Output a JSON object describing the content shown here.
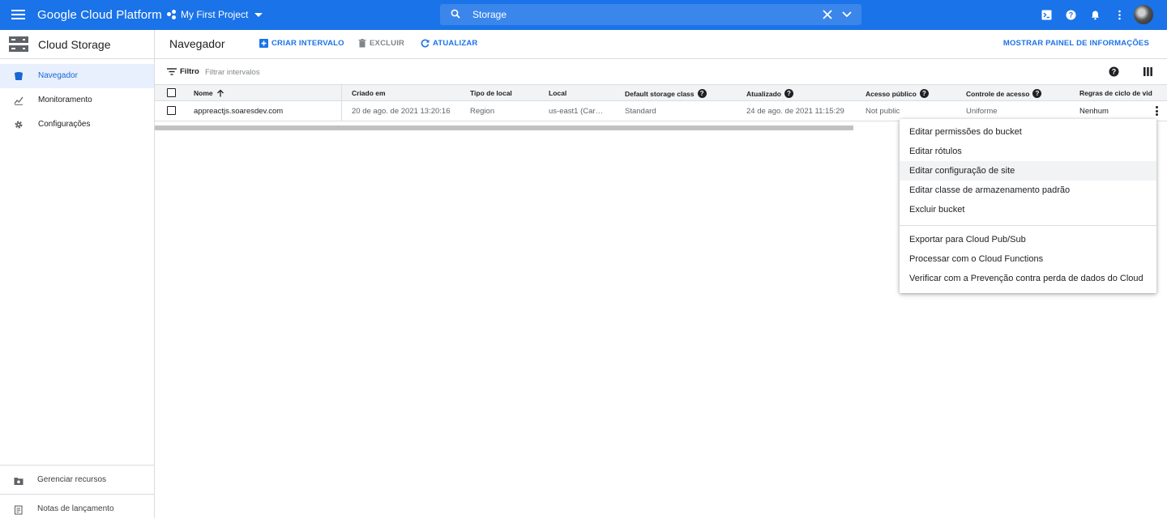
{
  "topbar": {
    "brand": "Google Cloud Platform",
    "project": "My First Project",
    "search_value": "Storage"
  },
  "sidebar": {
    "title": "Cloud Storage",
    "items": [
      {
        "label": "Navegador",
        "icon": "bucket-icon",
        "active": true
      },
      {
        "label": "Monitoramento",
        "icon": "chart-icon",
        "active": false
      },
      {
        "label": "Configurações",
        "icon": "gear-icon",
        "active": false
      }
    ],
    "bottom": [
      {
        "label": "Gerenciar recursos",
        "icon": "folder-gear-icon"
      },
      {
        "label": "Notas de lançamento",
        "icon": "notes-icon"
      }
    ]
  },
  "toolbar": {
    "title": "Navegador",
    "create_label": "CRIAR INTERVALO",
    "delete_label": "EXCLUIR",
    "refresh_label": "ATUALIZAR",
    "info_panel_label": "MOSTRAR PAINEL DE INFORMAÇÕES"
  },
  "filter": {
    "label": "Filtro",
    "placeholder": "Filtrar intervalos"
  },
  "table": {
    "columns": {
      "name": "Nome",
      "created": "Criado em",
      "location_type": "Tipo de local",
      "location": "Local",
      "storage_class": "Default storage class",
      "updated": "Atualizado",
      "public_access": "Acesso público",
      "access_control": "Controle de acesso",
      "lifecycle": "Regras de ciclo de vid"
    },
    "rows": [
      {
        "name": "appreactjs.soaresdev.com",
        "created": "20 de ago. de 2021 13:20:16",
        "location_type": "Region",
        "location": "us-east1 (Car…",
        "storage_class": "Standard",
        "updated": "24 de ago. de 2021 11:15:29",
        "public_access": "Not public",
        "access_control": "Uniforme",
        "lifecycle": "Nenhum"
      }
    ]
  },
  "menu": {
    "items": [
      "Editar permissões do bucket",
      "Editar rótulos",
      "Editar configuração de site",
      "Editar classe de armazenamento padrão",
      "Excluir bucket",
      "Exportar para Cloud Pub/Sub",
      "Processar com o Cloud Functions",
      "Verificar com a Prevenção contra perda de dados do Cloud"
    ]
  },
  "colors": {
    "brand_blue": "#1a73e8",
    "active_bg": "#e8f0fe",
    "border": "#dadce0"
  }
}
